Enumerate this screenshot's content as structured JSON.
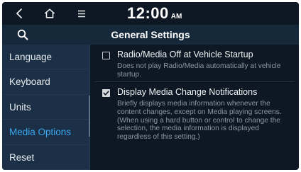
{
  "statusbar": {
    "time": "12:00",
    "ampm": "AM",
    "back_icon": "chevron-left-icon",
    "home_icon": "home-icon",
    "menu_icon": "menu-icon"
  },
  "header": {
    "title": "General Settings",
    "search_icon": "search-icon"
  },
  "sidebar": {
    "items": [
      {
        "label": "Language",
        "active": false
      },
      {
        "label": "Keyboard",
        "active": false
      },
      {
        "label": "Units",
        "active": false
      },
      {
        "label": "Media Options",
        "active": true
      },
      {
        "label": "Reset",
        "active": false
      }
    ]
  },
  "settings": [
    {
      "title": "Radio/Media Off at Vehicle Startup",
      "description": "Does not play Radio/Media automatically at vehicle startup.",
      "checked": false
    },
    {
      "title": "Display Media Change Notifications",
      "description": "Briefly displays media information whenever the content changes, except on Media playing screens. (When using a hard button or control to change the selection, the media information is displayed regardless of this setting.)",
      "checked": true
    }
  ],
  "colors": {
    "background": "#0d1824",
    "sidebar": "#1b3046",
    "accent": "#3aa6ec",
    "title_bar": "#16293a"
  }
}
